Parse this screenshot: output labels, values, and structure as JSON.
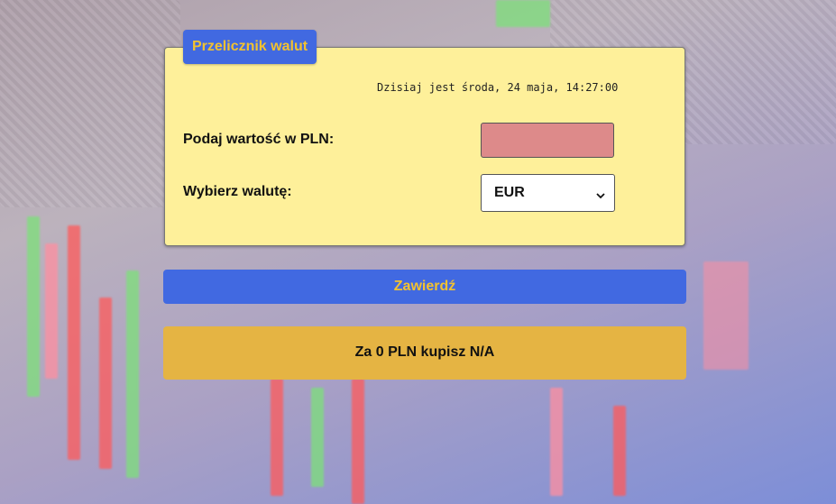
{
  "app": {
    "title": "Przelicznik walut"
  },
  "header": {
    "datetime": "Dzisiaj jest środa, 24 maja, 14:27:00"
  },
  "form": {
    "pln_label": "Podaj wartość w PLN:",
    "pln_value": "",
    "currency_label": "Wybierz walutę:",
    "currency_selected": "EUR"
  },
  "actions": {
    "submit_label": "Zawierdź"
  },
  "result": {
    "text": "Za 0 PLN kupisz N/A"
  },
  "colors": {
    "panel_bg": "#fef09a",
    "accent_blue": "#4169e1",
    "accent_gold": "#f2c230",
    "input_bg": "#dd8a8a",
    "result_bg": "#e5b443"
  }
}
